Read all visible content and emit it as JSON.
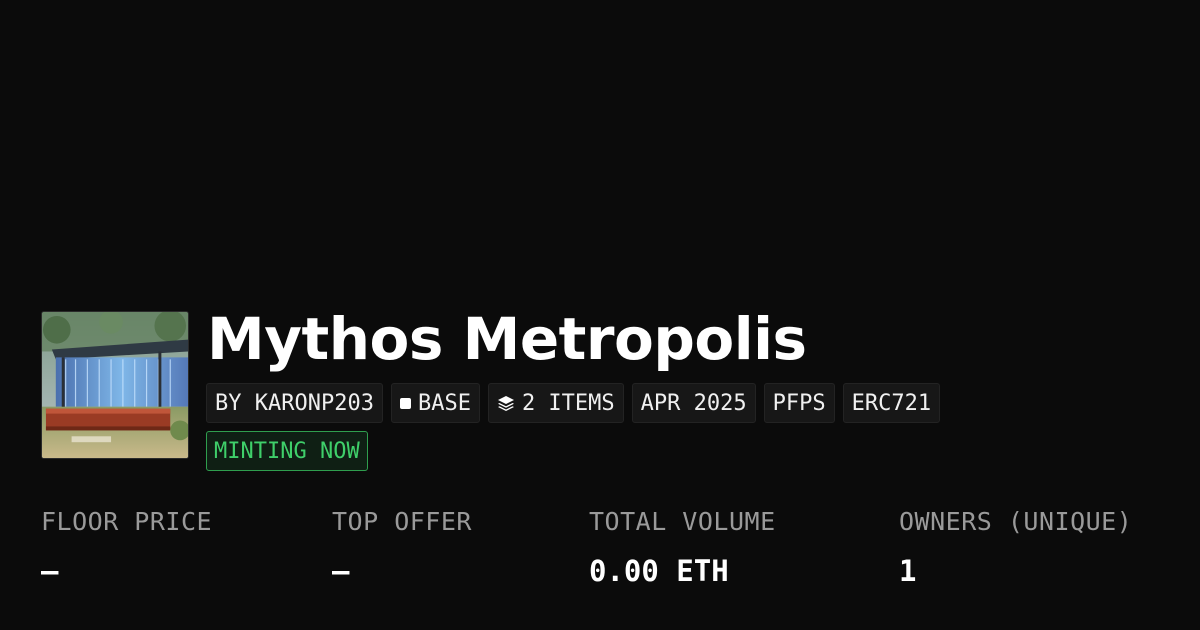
{
  "collection": {
    "name": "Mythos Metropolis",
    "thumbnail_alt": "Mythos Metropolis collection artwork"
  },
  "tags": [
    {
      "label": "BY KARONP203",
      "icon": ""
    },
    {
      "label": "BASE",
      "icon": "chain-square-icon"
    },
    {
      "label": "2 ITEMS",
      "icon": "layers-icon"
    },
    {
      "label": "APR 2025",
      "icon": ""
    },
    {
      "label": "PFPS",
      "icon": ""
    },
    {
      "label": "ERC721",
      "icon": ""
    }
  ],
  "status": {
    "label": "MINTING NOW",
    "color": "#3fcf6a"
  },
  "stats": [
    {
      "label": "FLOOR PRICE",
      "value": "–"
    },
    {
      "label": "TOP OFFER",
      "value": "–"
    },
    {
      "label": "TOTAL VOLUME",
      "value": "0.00 ETH"
    },
    {
      "label": "OWNERS (UNIQUE)",
      "value": "1"
    }
  ],
  "colors": {
    "background": "#0b0b0b",
    "accent_green": "#3fcf6a",
    "muted": "#9a9a9a"
  }
}
